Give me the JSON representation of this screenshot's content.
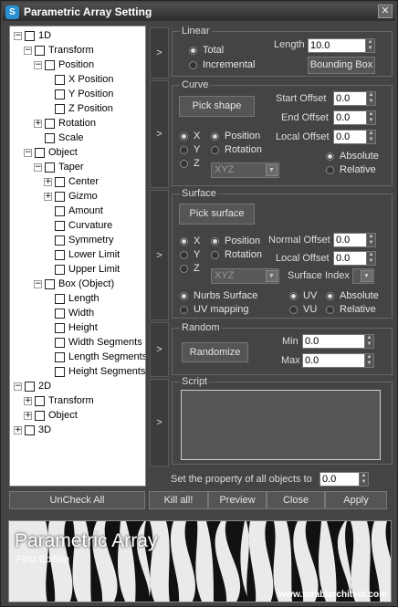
{
  "window": {
    "title": "Parametric Array Setting",
    "icon": "app-icon",
    "close_glyph": "✕"
  },
  "tree": {
    "nodes": [
      {
        "label": "1D",
        "expander": "−"
      },
      {
        "label": "Transform",
        "expander": "−"
      },
      {
        "label": "Position",
        "expander": "−"
      },
      {
        "label": "X Position",
        "expander": ""
      },
      {
        "label": "Y Position",
        "expander": ""
      },
      {
        "label": "Z Position",
        "expander": ""
      },
      {
        "label": "Rotation",
        "expander": "+"
      },
      {
        "label": "Scale",
        "expander": ""
      },
      {
        "label": "Object",
        "expander": "−"
      },
      {
        "label": "Taper",
        "expander": "−"
      },
      {
        "label": "Center",
        "expander": "+"
      },
      {
        "label": "Gizmo",
        "expander": "+"
      },
      {
        "label": "Amount",
        "expander": ""
      },
      {
        "label": "Curvature",
        "expander": ""
      },
      {
        "label": "Symmetry",
        "expander": ""
      },
      {
        "label": "Lower Limit",
        "expander": ""
      },
      {
        "label": "Upper Limit",
        "expander": ""
      },
      {
        "label": "Box (Object)",
        "expander": "−"
      },
      {
        "label": "Length",
        "expander": ""
      },
      {
        "label": "Width",
        "expander": ""
      },
      {
        "label": "Height",
        "expander": ""
      },
      {
        "label": "Width Segments",
        "expander": ""
      },
      {
        "label": "Length Segments",
        "expander": ""
      },
      {
        "label": "Height Segments",
        "expander": ""
      },
      {
        "label": "2D",
        "expander": "−"
      },
      {
        "label": "Transform",
        "expander": "+"
      },
      {
        "label": "Object",
        "expander": "+"
      },
      {
        "label": "3D",
        "expander": "+"
      }
    ]
  },
  "strip_glyph": ">",
  "linear": {
    "title": "Linear",
    "mode_total": "Total",
    "mode_incremental": "Incremental",
    "length_label": "Length",
    "length_value": "10.0",
    "bounding_box": "Bounding Box"
  },
  "curve": {
    "title": "Curve",
    "pick_shape": "Pick shape",
    "start_offset_label": "Start Offset",
    "start_offset_value": "0.0",
    "end_offset_label": "End Offset",
    "end_offset_value": "0.0",
    "local_offset_label": "Local Offset",
    "local_offset_value": "0.0",
    "axis_x": "X",
    "axis_y": "Y",
    "axis_z": "Z",
    "position": "Position",
    "rotation": "Rotation",
    "absolute": "Absolute",
    "relative": "Relative",
    "order_value": "XYZ"
  },
  "surface": {
    "title": "Surface",
    "pick_surface": "Pick surface",
    "axis_x": "X",
    "axis_y": "Y",
    "axis_z": "Z",
    "position": "Position",
    "rotation": "Rotation",
    "normal_offset_label": "Normal Offset",
    "normal_offset_value": "0.0",
    "local_offset_label": "Local Offset",
    "local_offset_value": "0.0",
    "order_value": "XYZ",
    "surface_index_label": "Surface Index",
    "nurbs_surface": "Nurbs Surface",
    "uv_mapping": "UV mapping",
    "uv": "UV",
    "vu": "VU",
    "absolute": "Absolute",
    "relative": "Relative"
  },
  "random": {
    "title": "Random",
    "randomize": "Randomize",
    "min_label": "Min",
    "min_value": "0.0",
    "max_label": "Max",
    "max_value": "0.0"
  },
  "script": {
    "title": "Script"
  },
  "set_property": {
    "label": "Set the property of all objects to",
    "value": "0.0"
  },
  "buttons": {
    "uncheck_all": "UnCheck All",
    "kill_all": "Kill all!",
    "preview": "Preview",
    "close": "Close",
    "apply": "Apply"
  },
  "banner": {
    "title": "Parametric Array",
    "subtitle": "First Edition",
    "url": "www.torabiarchitect.com"
  },
  "colors": {
    "window_bg": "#444444",
    "tree_bg": "#ffffff",
    "titlebar": "#3a3a3a"
  }
}
